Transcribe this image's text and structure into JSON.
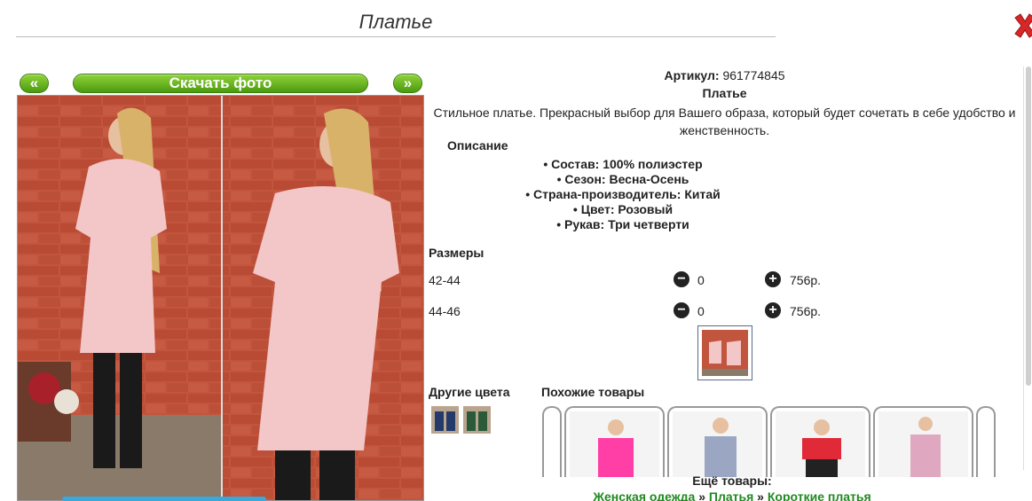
{
  "page_title": "Платье",
  "buttons": {
    "prev": "«",
    "download": "Скачать фото",
    "next": "»"
  },
  "product": {
    "article_label": "Артикул:",
    "article_value": "961774845",
    "name": "Платье",
    "description": "Стильное платье. Прекрасный выбор для Вашего образа, который будет сочетать в себе удобство и женственность.",
    "desc_heading": "Описание",
    "properties": [
      "Состав: 100% полиэстер",
      "Сезон: Весна-Осень",
      "Страна-производитель: Китай",
      "Цвет: Розовый",
      "Рукав: Три четверти"
    ]
  },
  "sizes": {
    "heading": "Размеры",
    "rows": [
      {
        "label": "42-44",
        "qty": "0",
        "price": "756р."
      },
      {
        "label": "44-46",
        "qty": "0",
        "price": "756р."
      }
    ]
  },
  "other_colors": {
    "heading": "Другие цвета"
  },
  "similar": {
    "heading": "Похожие товары"
  },
  "more": {
    "heading": "Ещё товары:",
    "crumbs": [
      "Женская одежда",
      "Платья",
      "Короткие платья"
    ],
    "sep": " » "
  },
  "colors": {
    "accent_green": "#4c9a10",
    "link_green": "#1f8a1f",
    "dress_pink": "#f3c6c8",
    "close_red": "#d62828"
  },
  "icons": [
    "close-icon",
    "minus-circle-icon",
    "plus-circle-icon"
  ]
}
